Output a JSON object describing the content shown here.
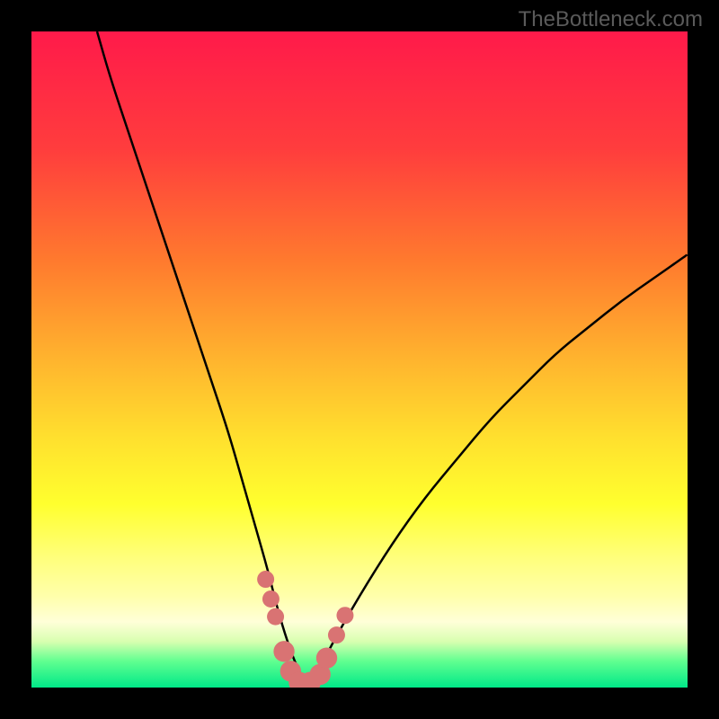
{
  "watermark": "TheBottleneck.com",
  "chart_data": {
    "type": "line",
    "title": "",
    "xlabel": "",
    "ylabel": "",
    "xlim": [
      0,
      100
    ],
    "ylim": [
      0,
      100
    ],
    "gradient_stops": [
      {
        "offset": 0,
        "color": "#ff1a4a"
      },
      {
        "offset": 18,
        "color": "#ff3d3d"
      },
      {
        "offset": 35,
        "color": "#ff7a2e"
      },
      {
        "offset": 50,
        "color": "#ffb42e"
      },
      {
        "offset": 62,
        "color": "#ffe02e"
      },
      {
        "offset": 72,
        "color": "#ffff2e"
      },
      {
        "offset": 80,
        "color": "#ffff7a"
      },
      {
        "offset": 86,
        "color": "#ffffaa"
      },
      {
        "offset": 90,
        "color": "#ffffd8"
      },
      {
        "offset": 93,
        "color": "#d8ffb0"
      },
      {
        "offset": 96,
        "color": "#60ff90"
      },
      {
        "offset": 100,
        "color": "#00e888"
      }
    ],
    "series": [
      {
        "name": "bottleneck-curve",
        "x": [
          10,
          12,
          15,
          18,
          21,
          24,
          27,
          30,
          32,
          34,
          36,
          37.5,
          39,
          40.5,
          42,
          44,
          46,
          50,
          55,
          60,
          65,
          70,
          75,
          80,
          85,
          90,
          95,
          100
        ],
        "y": [
          100,
          93,
          84,
          75,
          66,
          57,
          48,
          39,
          32,
          25,
          18,
          12,
          7,
          3,
          0.5,
          3,
          7,
          14,
          22,
          29,
          35,
          41,
          46,
          51,
          55,
          59,
          62.5,
          66
        ]
      }
    ],
    "markers": [
      {
        "x": 35.7,
        "y": 16.5,
        "r": 1.3
      },
      {
        "x": 36.5,
        "y": 13.5,
        "r": 1.3
      },
      {
        "x": 37.2,
        "y": 10.8,
        "r": 1.3
      },
      {
        "x": 38.5,
        "y": 5.5,
        "r": 1.6
      },
      {
        "x": 39.5,
        "y": 2.5,
        "r": 1.6
      },
      {
        "x": 40.8,
        "y": 0.8,
        "r": 1.6
      },
      {
        "x": 42.5,
        "y": 0.8,
        "r": 1.6
      },
      {
        "x": 44,
        "y": 2,
        "r": 1.6
      },
      {
        "x": 45,
        "y": 4.5,
        "r": 1.6
      },
      {
        "x": 46.5,
        "y": 8,
        "r": 1.3
      },
      {
        "x": 47.8,
        "y": 11,
        "r": 1.3
      }
    ]
  }
}
